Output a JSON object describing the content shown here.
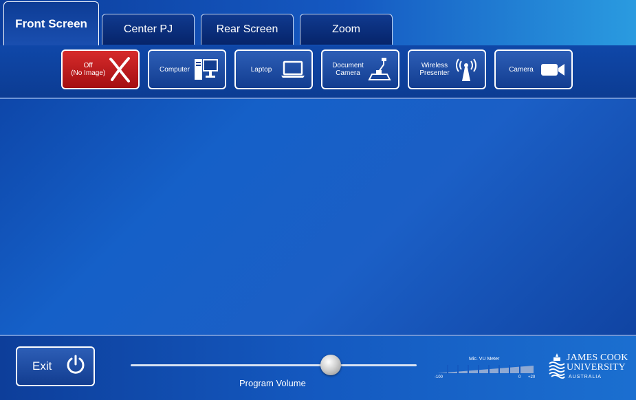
{
  "tabs": [
    {
      "label": "Front Screen",
      "active": true
    },
    {
      "label": "Center PJ",
      "active": false
    },
    {
      "label": "Rear Screen",
      "active": false
    },
    {
      "label": "Zoom",
      "active": false
    }
  ],
  "sources": [
    {
      "label": "Off\n(No Image)",
      "icon": "x-icon"
    },
    {
      "label": "Computer",
      "icon": "computer-icon"
    },
    {
      "label": "Laptop",
      "icon": "laptop-icon"
    },
    {
      "label": "Document\nCamera",
      "icon": "document-camera-icon"
    },
    {
      "label": "Wireless\nPresenter",
      "icon": "wireless-antenna-icon"
    },
    {
      "label": "Camera",
      "icon": "video-camera-icon"
    }
  ],
  "exit": {
    "label": "Exit",
    "icon": "power-icon"
  },
  "volume": {
    "label": "Program Volume",
    "level": 0.7
  },
  "vu_meter": {
    "title": "Mic. VU Meter",
    "ticks": [
      "-100",
      "0",
      "+20"
    ]
  },
  "logo": {
    "line1": "JAMES COOK",
    "line2": "UNIVERSITY",
    "line3": "AUSTRALIA"
  },
  "colors": {
    "off_button": "#c01b1e",
    "accent": "#1559c2"
  }
}
